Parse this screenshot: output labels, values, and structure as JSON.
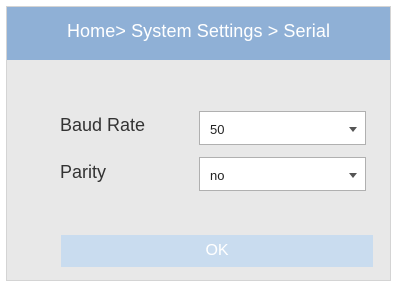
{
  "header": {
    "breadcrumb": "Home> System Settings > Serial"
  },
  "form": {
    "baud_rate": {
      "label": "Baud Rate",
      "value": "50"
    },
    "parity": {
      "label": "Parity",
      "value": "no"
    }
  },
  "actions": {
    "ok_label": "OK"
  },
  "icons": {
    "dropdown": "chevron-down-icon"
  },
  "colors": {
    "header_bg": "#8fb0d6",
    "panel_bg": "#e8e8e8",
    "ok_button_bg": "#c9dcef",
    "header_text": "#ffffff"
  }
}
